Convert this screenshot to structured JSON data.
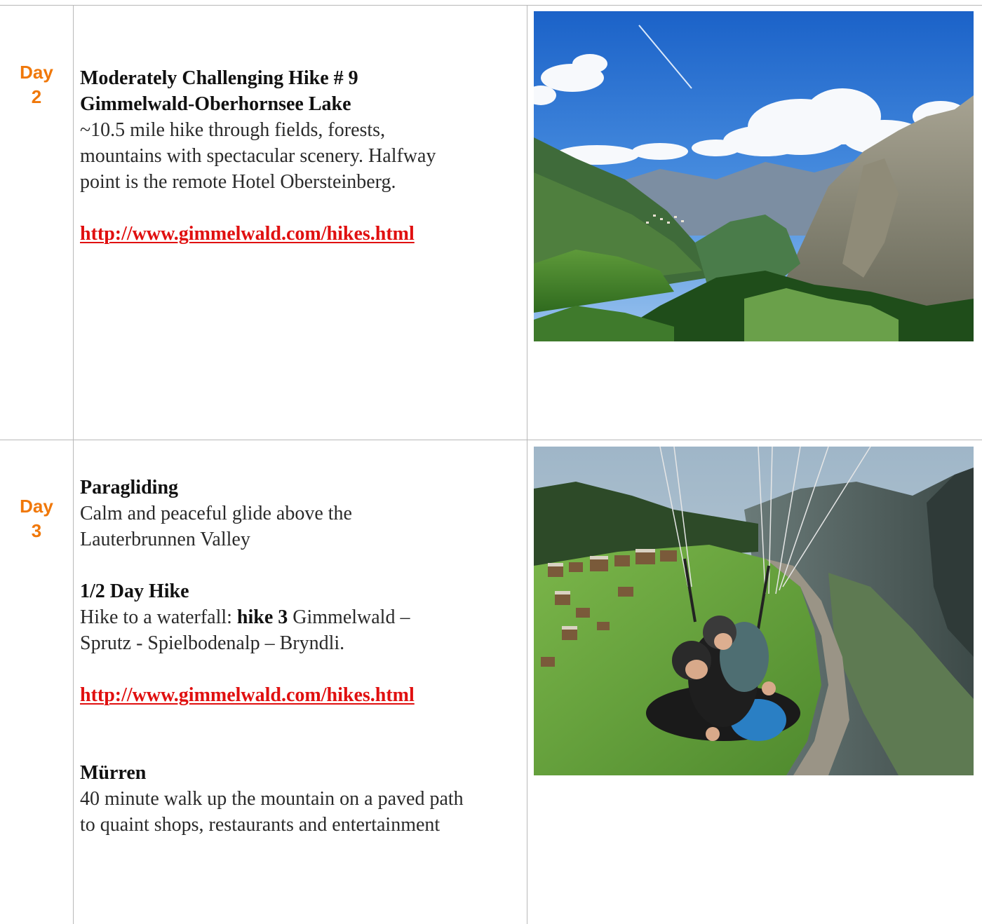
{
  "rows": [
    {
      "day_word": "Day",
      "day_num": "2",
      "title1": "Moderately Challenging Hike # 9",
      "title2": "Gimmelwald-Oberhornsee Lake",
      "desc1": "~10.5 mile hike through fields, forests,",
      "desc2": "mountains with spectacular scenery. Halfway",
      "desc3": "point is the remote Hotel Obersteinberg.",
      "link": "http://www.gimmelwald.com/hikes.html",
      "photo_icon": "alpine-valley-photo"
    },
    {
      "day_word": "Day",
      "day_num": "3",
      "section1_title": "Paragliding",
      "section1_line1": "Calm and peaceful glide above the",
      "section1_line2": "Lauterbrunnen Valley",
      "section2_title": "1/2 Day Hike",
      "section2_line1_pre": "Hike to a waterfall: ",
      "section2_line1_bold": "hike 3",
      "section2_line1_post": " Gimmelwald –",
      "section2_line2": "Sprutz - Spielbodenalp – Bryndli.",
      "link": "http://www.gimmelwald.com/hikes.html",
      "section3_title": "Mürren",
      "section3_line1": "40 minute walk up the mountain on a paved path",
      "section3_line2": "to quaint shops, restaurants and entertainment",
      "photo_icon": "paragliding-photo"
    }
  ],
  "colors": {
    "day_label": "#f0780a",
    "link": "#e01010",
    "grid": "#b8b8b8"
  }
}
